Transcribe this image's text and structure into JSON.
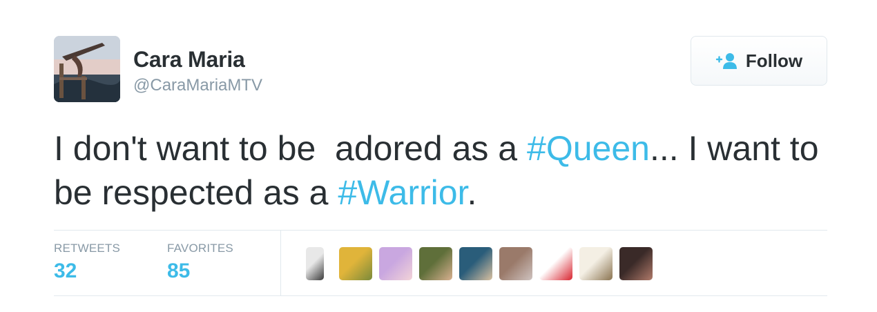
{
  "tweet": {
    "author": {
      "display_name": "Cara Maria",
      "screen_name": "@CaraMariaMTV"
    },
    "follow_label": "Follow",
    "text_parts": [
      "I don't want to be  adored as a ",
      "#Queen",
      "... I want to be respected as a ",
      "#Warrior",
      "."
    ],
    "stats": {
      "retweets_label": "RETWEETS",
      "retweets_count": "32",
      "favorites_label": "FAVORITES",
      "favorites_count": "85"
    }
  },
  "colors": {
    "hashtag": "#3dbbe8",
    "text": "#292f33",
    "muted": "#8899a6",
    "divider": "#e1e8ed"
  },
  "favoriter_avatars": [
    {
      "name": "favoriter-1",
      "colors": [
        "#e8e8e8",
        "#3a3a3a"
      ]
    },
    {
      "name": "favoriter-2",
      "colors": [
        "#e0b43a",
        "#7a8a3a"
      ]
    },
    {
      "name": "favoriter-3",
      "colors": [
        "#c9a7e0",
        "#f2d3d8"
      ]
    },
    {
      "name": "favoriter-4",
      "colors": [
        "#5f6f3a",
        "#d8b090"
      ]
    },
    {
      "name": "favoriter-5",
      "colors": [
        "#2a5d7a",
        "#d9c0a0"
      ]
    },
    {
      "name": "favoriter-6",
      "colors": [
        "#9a7a6a",
        "#cfc3c0"
      ]
    },
    {
      "name": "favoriter-7",
      "colors": [
        "#ffffff",
        "#d8242f"
      ]
    },
    {
      "name": "favoriter-8",
      "colors": [
        "#f4efe4",
        "#8a7350"
      ]
    },
    {
      "name": "favoriter-9",
      "colors": [
        "#3a2a28",
        "#b07a6a"
      ]
    }
  ]
}
